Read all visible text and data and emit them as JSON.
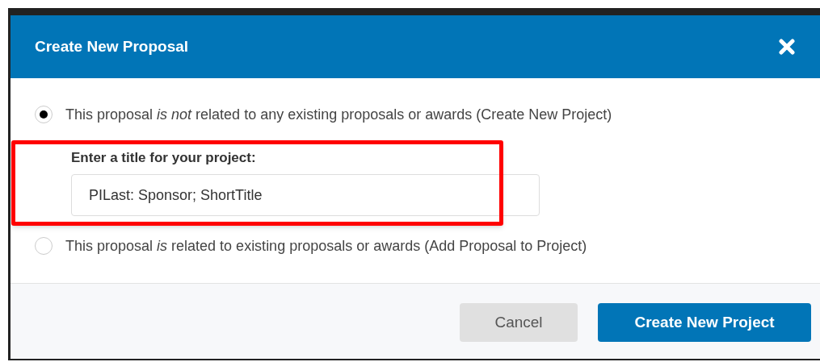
{
  "dialog": {
    "title": "Create New Proposal"
  },
  "options": [
    {
      "label": "This proposal *is not* related to any existing proposals or awards (Create New Project)",
      "selected": true
    },
    {
      "label": "This proposal *is* related to existing proposals or awards (Add Proposal to Project)",
      "selected": false
    }
  ],
  "title_field": {
    "label": "Enter a title for your project:",
    "value": "PILast: Sponsor; ShortTitle",
    "highlighted": true
  },
  "buttons": [
    {
      "label": "Cancel",
      "kind": "secondary"
    },
    {
      "label": "Create New Project",
      "kind": "primary"
    }
  ]
}
